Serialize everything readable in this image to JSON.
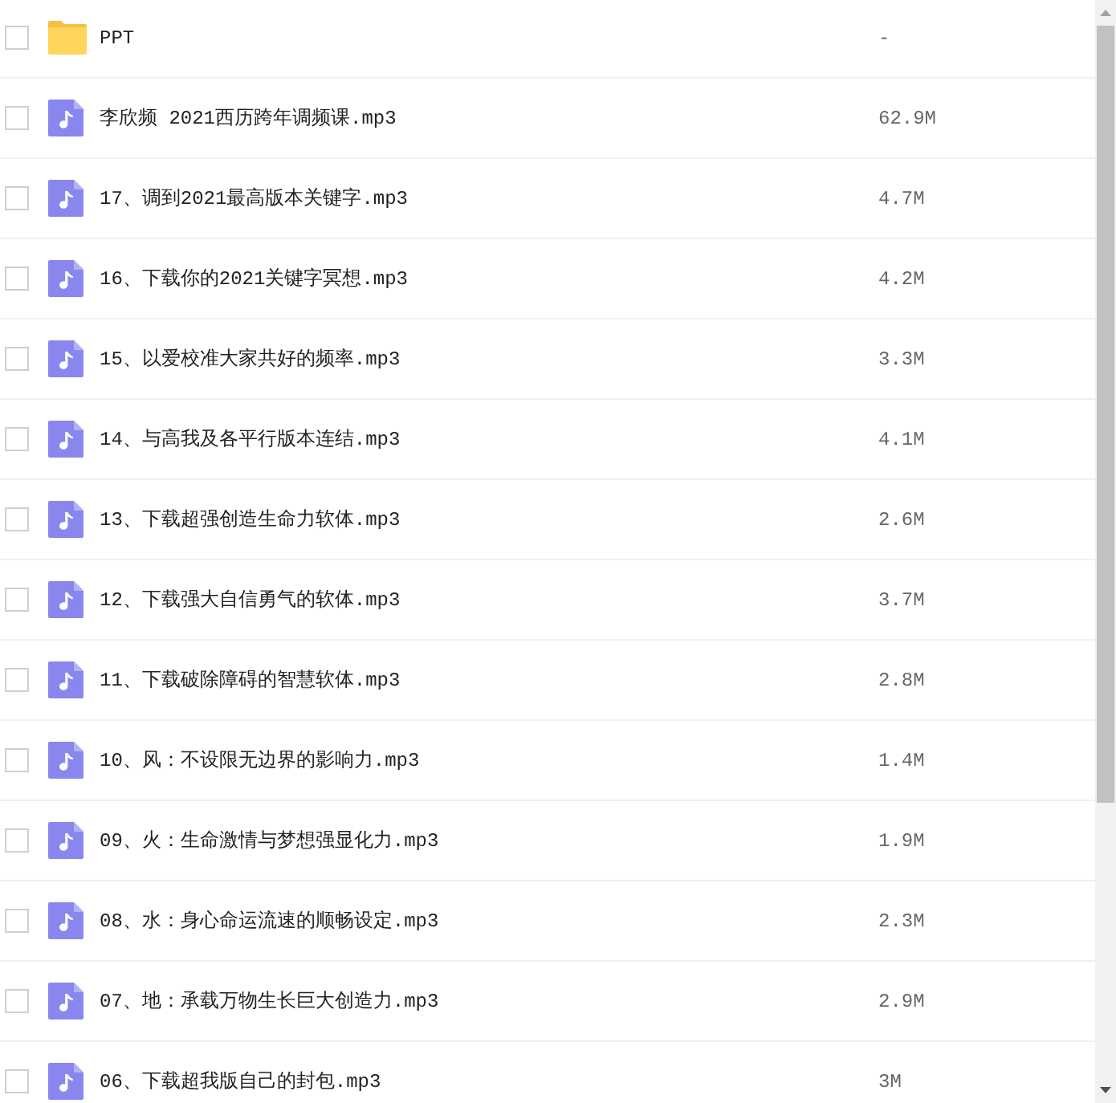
{
  "files": [
    {
      "kind": "folder",
      "name": "PPT",
      "size": "-",
      "checked": false
    },
    {
      "kind": "audio",
      "name": "李欣频 2021西历跨年调频课.mp3",
      "size": "62.9M",
      "checked": false
    },
    {
      "kind": "audio",
      "name": "17、调到2021最高版本关键字.mp3",
      "size": "4.7M",
      "checked": false
    },
    {
      "kind": "audio",
      "name": "16、下载你的2021关键字冥想.mp3",
      "size": "4.2M",
      "checked": false
    },
    {
      "kind": "audio",
      "name": "15、以爱校准大家共好的频率.mp3",
      "size": "3.3M",
      "checked": false
    },
    {
      "kind": "audio",
      "name": "14、与高我及各平行版本连结.mp3",
      "size": "4.1M",
      "checked": false
    },
    {
      "kind": "audio",
      "name": "13、下载超强创造生命力软体.mp3",
      "size": "2.6M",
      "checked": false
    },
    {
      "kind": "audio",
      "name": "12、下载强大自信勇气的软体.mp3",
      "size": "3.7M",
      "checked": false
    },
    {
      "kind": "audio",
      "name": "11、下载破除障碍的智慧软体.mp3",
      "size": "2.8M",
      "checked": false
    },
    {
      "kind": "audio",
      "name": "10、风：不设限无边界的影响力.mp3",
      "size": "1.4M",
      "checked": false
    },
    {
      "kind": "audio",
      "name": "09、火：生命激情与梦想强显化力.mp3",
      "size": "1.9M",
      "checked": false
    },
    {
      "kind": "audio",
      "name": "08、水：身心命运流速的顺畅设定.mp3",
      "size": "2.3M",
      "checked": false
    },
    {
      "kind": "audio",
      "name": "07、地：承载万物生长巨大创造力.mp3",
      "size": "2.9M",
      "checked": false
    },
    {
      "kind": "audio",
      "name": "06、下载超我版自己的封包.mp3",
      "size": "3M",
      "checked": false
    }
  ]
}
